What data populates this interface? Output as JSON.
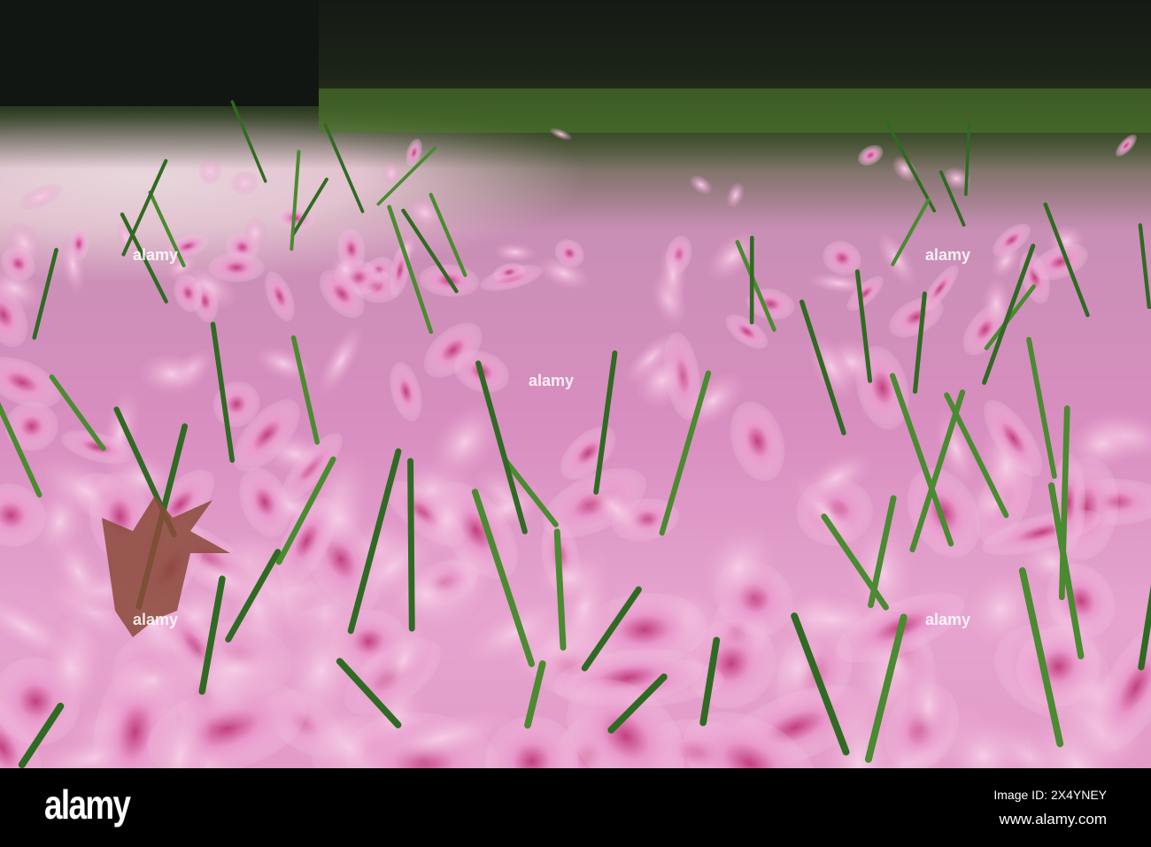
{
  "photo": {
    "subject": "fallen pink petals on grass"
  },
  "watermark": {
    "text": "alamy"
  },
  "footer": {
    "logo": "alamy",
    "image_id": "Image ID: 2X4YNEY",
    "website": "www.alamy.com"
  }
}
